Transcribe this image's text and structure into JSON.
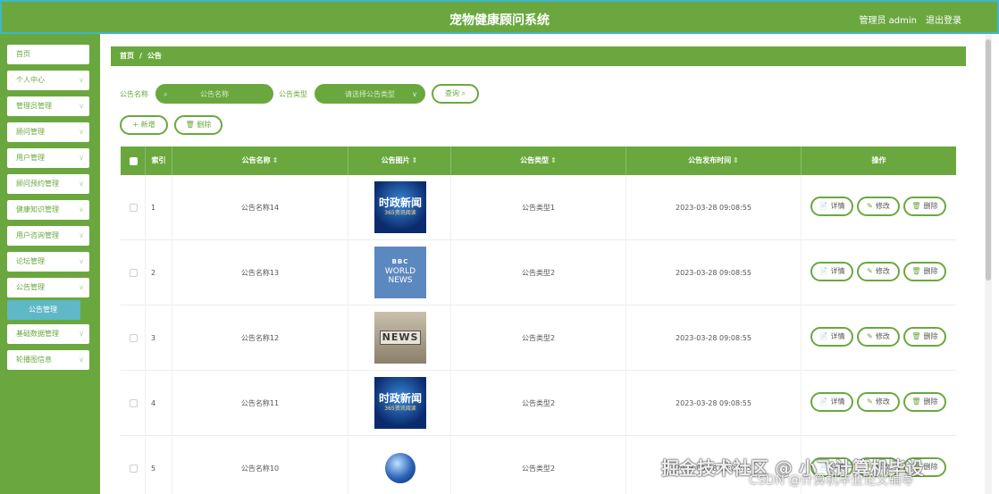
{
  "app": {
    "title": "宠物健康顾问系统",
    "user": "管理员 admin",
    "logout": "退出登录"
  },
  "sidebar": {
    "items": [
      {
        "label": "首页",
        "chevron": false
      },
      {
        "label": "个人中心",
        "chevron": true
      },
      {
        "label": "管理员管理",
        "chevron": true
      },
      {
        "label": "顾问管理",
        "chevron": true
      },
      {
        "label": "用户管理",
        "chevron": true
      },
      {
        "label": "顾问预约管理",
        "chevron": true
      },
      {
        "label": "健康知识管理",
        "chevron": true
      },
      {
        "label": "用户咨询管理",
        "chevron": true
      },
      {
        "label": "论坛管理",
        "chevron": true
      },
      {
        "label": "公告管理",
        "chevron": true,
        "sub": "公告管理"
      },
      {
        "label": "基础数据管理",
        "chevron": true
      },
      {
        "label": "轮播图信息",
        "chevron": true
      }
    ],
    "chevron": "∨"
  },
  "breadcrumb": {
    "home": "首页",
    "separator": "/",
    "current": "公告"
  },
  "search": {
    "name_label": "公告名称",
    "name_placeholder": "公告名称",
    "type_label": "公告类型",
    "type_placeholder": "请选择公告类型",
    "query_button": "查询"
  },
  "actions": {
    "add": "新增",
    "delete": "删除"
  },
  "table": {
    "columns": [
      "索引",
      "公告名称",
      "公告图片",
      "公告类型",
      "公告发布时间",
      "操作"
    ],
    "sort_icon": "⇕",
    "rows": [
      {
        "index": "1",
        "name": "公告名称14",
        "image": "shizheng",
        "type": "公告类型1",
        "time": "2023-03-28 09:08:55"
      },
      {
        "index": "2",
        "name": "公告名称13",
        "image": "bbc",
        "type": "公告类型2",
        "time": "2023-03-28 09:08:55"
      },
      {
        "index": "3",
        "name": "公告名称12",
        "image": "news",
        "type": "公告类型2",
        "time": "2023-03-28 09:08:55"
      },
      {
        "index": "4",
        "name": "公告名称11",
        "image": "shizheng",
        "type": "公告类型2",
        "time": "2023-03-28 09:08:55"
      },
      {
        "index": "5",
        "name": "公告名称10",
        "image": "globe",
        "type": "公告类型2",
        "time": "2023-03-28 09:08:55"
      }
    ],
    "ops": {
      "detail": "详情",
      "edit": "修改",
      "delete": "删除"
    }
  },
  "images": {
    "shizheng_text": "时政新闻",
    "shizheng_sub": "365资讯阅读",
    "bbc_logo": "BBC",
    "bbc_line1": "WORLD",
    "bbc_line2": "NEWS",
    "news_text": "NEWS"
  },
  "watermark": {
    "line1": "掘金技术社区 @ 小飞计算机毕设",
    "line2": "CSDN @计算机毕业论文辅导"
  },
  "colors": {
    "primary": "#6aa83f",
    "accent": "#5fb8c6",
    "header_border": "#3fb7c9"
  }
}
